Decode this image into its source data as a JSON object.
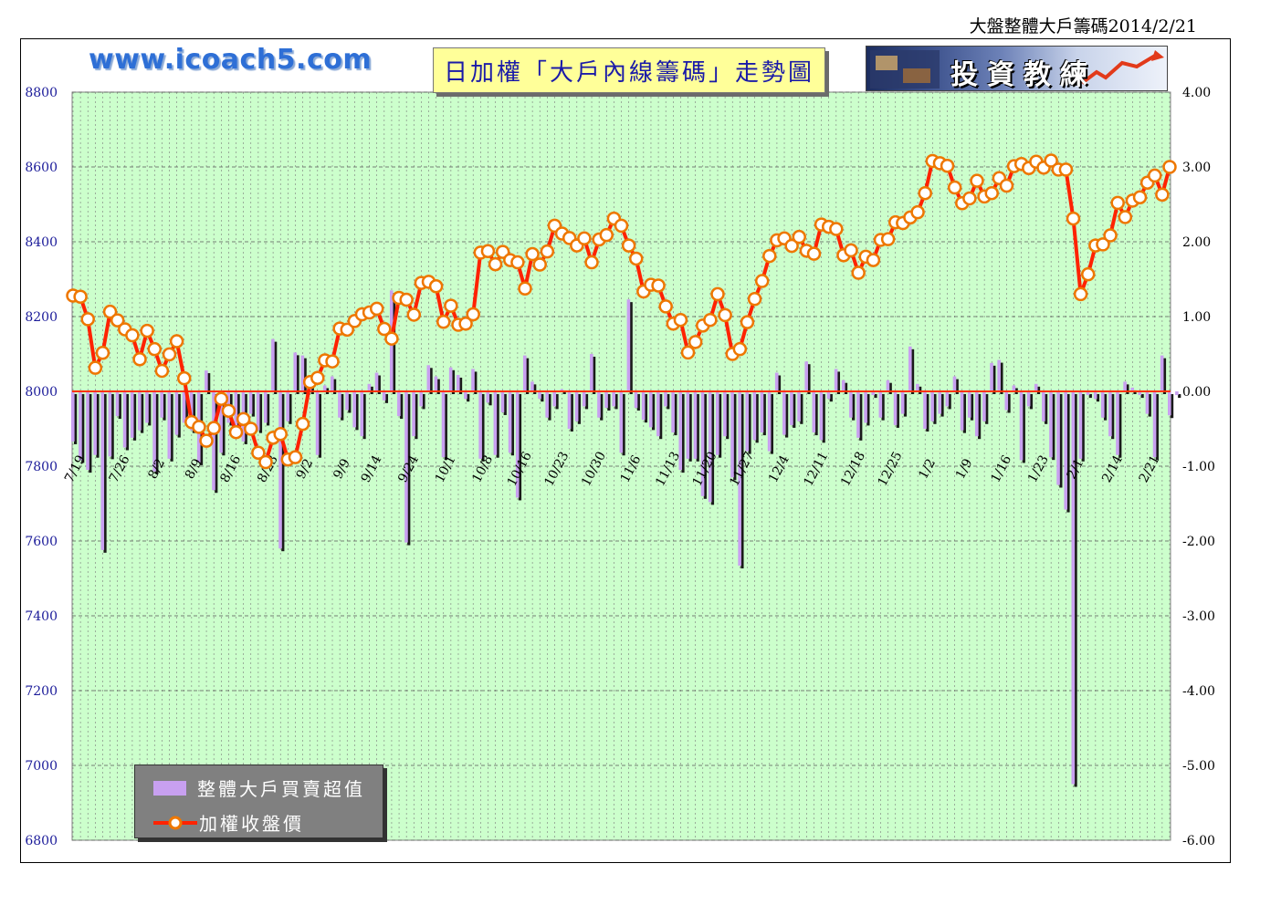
{
  "header": {
    "date_title": "大盤整體大戶籌碼2014/2/21"
  },
  "banner": {
    "website": "www.icoach5.com",
    "title": "日加權「大戶內線籌碼」走勢圖",
    "logo_text": "投資教練"
  },
  "legend": {
    "bar_label": "整體大戶買賣超值",
    "line_label": "加權收盤價"
  },
  "colors": {
    "plot_bg": "#ccffcc",
    "bar": "#c8a0f0",
    "line": "#ff2200",
    "marker_fill": "#ffffff",
    "marker_edge": "#ee7700",
    "left_axis": "#1a1a99"
  },
  "chart_data": {
    "type": "bar+line",
    "x_tick_labels": [
      "7/19",
      "7/26",
      "8/2",
      "8/9",
      "8/16",
      "8/23",
      "9/2",
      "9/9",
      "9/14",
      "9/24",
      "10/1",
      "10/8",
      "10/16",
      "10/23",
      "10/30",
      "11/6",
      "11/13",
      "11/20",
      "11/27",
      "12/4",
      "12/11",
      "12/18",
      "12/25",
      "1/2",
      "1/9",
      "1/16",
      "1/23",
      "2/1",
      "2/14",
      "2/21"
    ],
    "x_tick_positions": [
      0,
      6,
      11,
      16,
      21,
      26,
      31,
      36,
      40,
      45,
      50,
      55,
      60,
      65,
      70,
      75,
      80,
      85,
      90,
      95,
      100,
      105,
      110,
      115,
      120,
      125,
      130,
      135,
      140,
      145
    ],
    "y_left": {
      "min": 6800,
      "max": 8800,
      "ticks": [
        6800,
        7000,
        7200,
        7400,
        7600,
        7800,
        8000,
        8200,
        8400,
        8600,
        8800
      ]
    },
    "y_right": {
      "min": -6.0,
      "max": 4.0,
      "ticks": [
        "4.00",
        "3.00",
        "2.00",
        "1.00",
        "0.00",
        "-1.00",
        "-2.00",
        "-3.00",
        "-4.00",
        "-5.00",
        "-6.00"
      ]
    },
    "series": [
      {
        "name": "整體大戶買賣超值",
        "axis": "right",
        "type": "bar",
        "values": [
          -0.67,
          -0.92,
          -1.05,
          -0.85,
          -2.12,
          -0.87,
          -0.33,
          -0.75,
          -0.62,
          -0.52,
          -0.42,
          -1.07,
          -0.35,
          -0.9,
          -0.58,
          -0.42,
          -0.52,
          -0.95,
          0.28,
          -1.32,
          -0.82,
          -0.42,
          -0.45,
          -0.67,
          -0.3,
          -0.52,
          -0.42,
          0.7,
          -2.1,
          -0.4,
          0.52,
          0.48,
          0.2,
          -0.85,
          0.08,
          0.2,
          -0.35,
          -0.25,
          -0.48,
          -0.6,
          0.1,
          0.25,
          -0.12,
          1.35,
          -0.33,
          -2.02,
          -0.6,
          -0.2,
          0.35,
          0.2,
          -0.88,
          0.32,
          0.22,
          -0.1,
          0.3,
          -0.9,
          -0.15,
          -0.85,
          -0.28,
          -0.82,
          -1.42,
          0.48,
          0.13,
          -0.1,
          -0.35,
          -0.2,
          0.03,
          -0.5,
          -0.4,
          -0.2,
          0.5,
          -0.35,
          -0.22,
          -0.2,
          -0.82,
          1.23,
          -0.22,
          -0.38,
          -0.48,
          -0.6,
          -0.2,
          -0.55,
          -1.05,
          -0.9,
          -0.9,
          -1.4,
          -1.48,
          -0.85,
          -0.6,
          -1.15,
          -2.33,
          -0.8,
          -0.65,
          -0.55,
          -0.8,
          0.25,
          -0.58,
          -0.45,
          -0.4,
          0.4,
          -0.55,
          -0.65,
          -0.1,
          0.3,
          0.15,
          -0.35,
          -0.62,
          -0.42,
          -0.05,
          -0.35,
          0.15,
          -0.45,
          -0.3,
          0.6,
          0.1,
          -0.5,
          -0.4,
          -0.3,
          -0.2,
          0.2,
          -0.52,
          -0.35,
          -0.6,
          -0.4,
          0.38,
          0.42,
          -0.25,
          0.08,
          -0.92,
          -0.2,
          0.1,
          -0.4,
          -0.88,
          -1.25,
          -1.58,
          -5.25,
          -0.9,
          -0.05,
          -0.1,
          -0.35,
          -0.6,
          -0.85,
          0.13,
          0.05,
          -0.05,
          -0.3,
          -0.88,
          0.48,
          -0.32,
          -0.05
        ]
      },
      {
        "name": "加權收盤價",
        "axis": "left",
        "type": "line",
        "values": [
          8256,
          8253,
          8193,
          8063,
          8103,
          8213,
          8190,
          8166,
          8150,
          8086,
          8162,
          8113,
          8055,
          8099,
          8134,
          8035,
          7918,
          7905,
          7868,
          7902,
          7980,
          7948,
          7891,
          7926,
          7900,
          7836,
          7811,
          7876,
          7886,
          7818,
          7824,
          7913,
          8025,
          8036,
          8083,
          8080,
          8168,
          8165,
          8188,
          8206,
          8211,
          8221,
          8167,
          8141,
          8250,
          8245,
          8205,
          8290,
          8293,
          8281,
          8186,
          8229,
          8178,
          8181,
          8206,
          8371,
          8375,
          8340,
          8373,
          8351,
          8345,
          8275,
          8367,
          8339,
          8374,
          8443,
          8422,
          8410,
          8390,
          8409,
          8345,
          8406,
          8418,
          8462,
          8443,
          8390,
          8355,
          8267,
          8285,
          8283,
          8227,
          8181,
          8191,
          8104,
          8132,
          8176,
          8191,
          8260,
          8204,
          8100,
          8113,
          8185,
          8247,
          8295,
          8362,
          8404,
          8409,
          8389,
          8413,
          8376,
          8368,
          8446,
          8440,
          8434,
          8364,
          8377,
          8317,
          8360,
          8351,
          8405,
          8407,
          8452,
          8450,
          8465,
          8479,
          8530,
          8616,
          8610,
          8603,
          8545,
          8503,
          8516,
          8563,
          8521,
          8530,
          8570,
          8550,
          8602,
          8608,
          8597,
          8614,
          8598,
          8617,
          8593,
          8593,
          8462,
          8260,
          8313,
          8390,
          8393,
          8417,
          8504,
          8466,
          8510,
          8519,
          8558,
          8577,
          8526,
          8600
        ]
      }
    ]
  }
}
